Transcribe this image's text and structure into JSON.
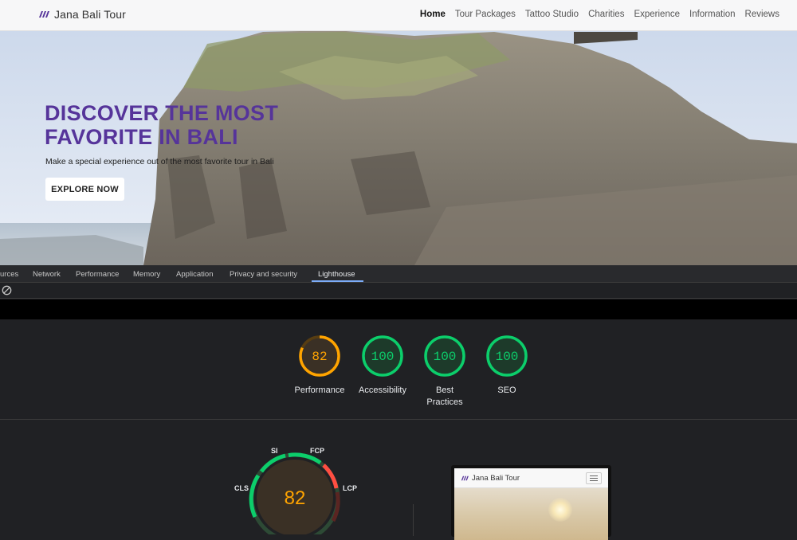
{
  "site": {
    "brand": "Jana Bali Tour",
    "nav": [
      {
        "label": "Home",
        "active": true
      },
      {
        "label": "Tour Packages",
        "active": false
      },
      {
        "label": "Tattoo Studio",
        "active": false
      },
      {
        "label": "Charities",
        "active": false
      },
      {
        "label": "Experience",
        "active": false
      },
      {
        "label": "Information",
        "active": false
      },
      {
        "label": "Reviews",
        "active": false
      }
    ],
    "hero": {
      "title": "DISCOVER THE MOST FAVORITE IN BALI",
      "subtitle": "Make a special experience out of the most favorite tour in Bali",
      "button": "EXPLORE NOW"
    }
  },
  "devtools": {
    "tabs": [
      {
        "label": "urces",
        "active": false
      },
      {
        "label": "Network",
        "active": false
      },
      {
        "label": "Performance",
        "active": false
      },
      {
        "label": "Memory",
        "active": false
      },
      {
        "label": "Application",
        "active": false
      },
      {
        "label": "Privacy and security",
        "active": false
      },
      {
        "label": "Lighthouse",
        "active": true
      }
    ],
    "toolbar_icon": "clear-icon"
  },
  "lighthouse": {
    "scores": [
      {
        "value": "82",
        "label": "Performance",
        "score": 0.82,
        "color": "#ffa400",
        "track": "#573d12",
        "fill": "#3a3025"
      },
      {
        "value": "100",
        "label": "Accessibility",
        "score": 1.0,
        "color": "#0cce6b",
        "track": "#0b4d2a",
        "fill": "#1d3a2a"
      },
      {
        "value": "100",
        "label": "Best Practices",
        "score": 1.0,
        "color": "#0cce6b",
        "track": "#0b4d2a",
        "fill": "#1d3a2a"
      },
      {
        "value": "100",
        "label": "SEO",
        "score": 1.0,
        "color": "#0cce6b",
        "track": "#0b4d2a",
        "fill": "#1d3a2a"
      }
    ],
    "performance_detail": {
      "score": "82",
      "metrics": [
        "SI",
        "FCP",
        "LCP",
        "CLS"
      ]
    },
    "preview": {
      "brand": "Jana Bali Tour"
    }
  },
  "colors": {
    "brand_purple": "#56349a",
    "score_orange": "#ffa400",
    "score_green": "#0cce6b",
    "score_red": "#ff4e42",
    "tab_accent": "#7cacf8"
  }
}
